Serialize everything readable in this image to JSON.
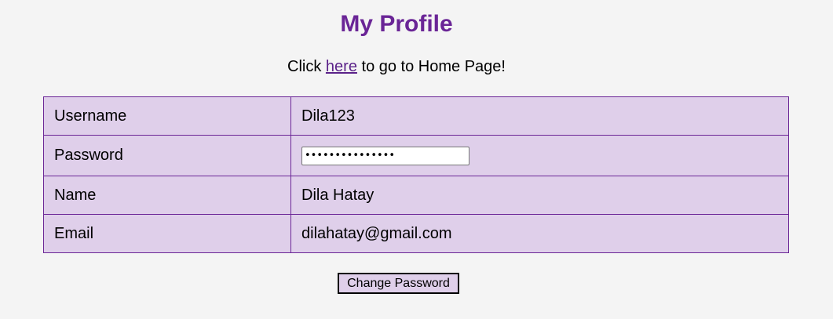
{
  "page": {
    "title": "My Profile"
  },
  "home_link": {
    "prefix": "Click ",
    "link_text": "here",
    "suffix": " to go to Home Page!"
  },
  "profile": {
    "rows": [
      {
        "label": "Username",
        "value": "Dila123"
      },
      {
        "label": "Password",
        "value": "•••••••••••••••"
      },
      {
        "label": "Name",
        "value": "Dila Hatay"
      },
      {
        "label": "Email",
        "value": "dilahatay@gmail.com"
      }
    ]
  },
  "actions": {
    "change_password_label": "Change Password"
  },
  "colors": {
    "accent": "#6a2596",
    "table_bg": "#dfcfea",
    "page_bg": "#f4f4f4"
  }
}
